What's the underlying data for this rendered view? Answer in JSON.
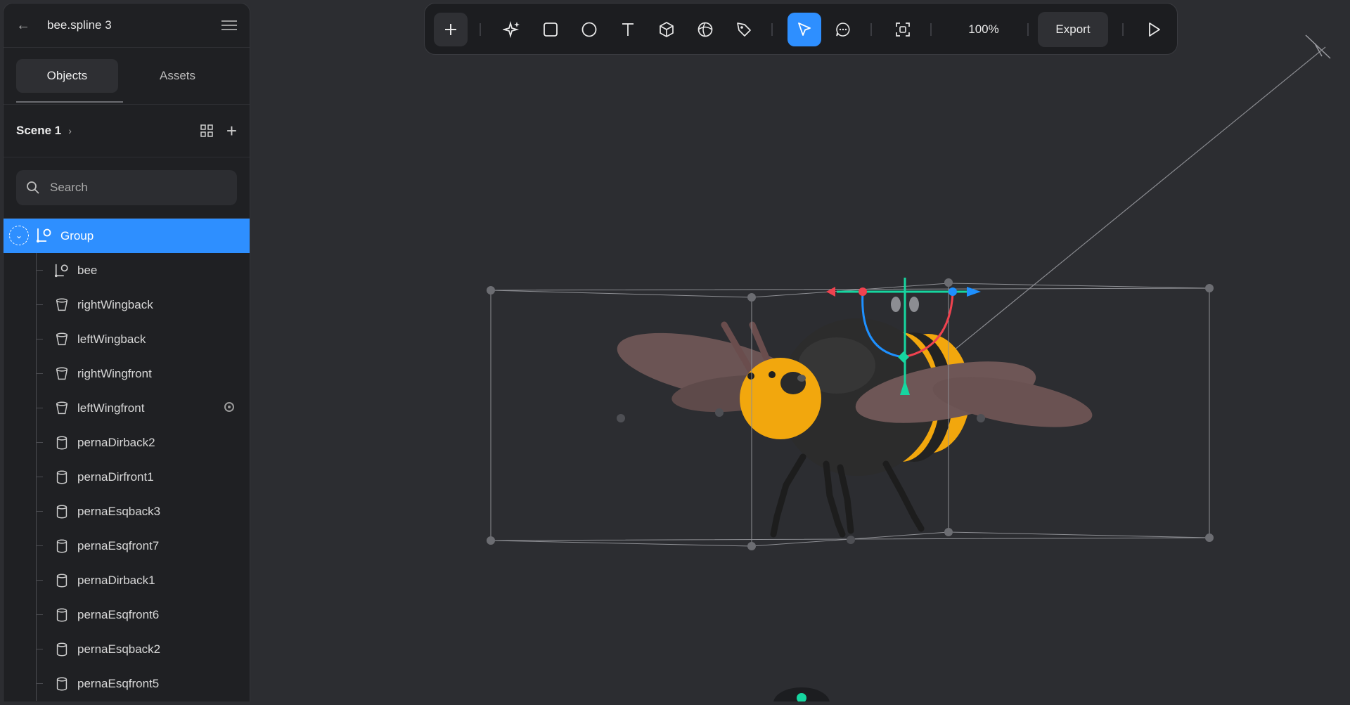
{
  "app": {
    "file_title": "bee.spline 3"
  },
  "sidebar": {
    "tabs": [
      {
        "label": "Objects"
      },
      {
        "label": "Assets"
      }
    ],
    "scene": {
      "label": "Scene 1"
    },
    "search": {
      "placeholder": "Search"
    },
    "selected_item": {
      "label": "Group"
    },
    "items": [
      {
        "label": "bee",
        "icon": "group-icon"
      },
      {
        "label": "rightWingback",
        "icon": "cup-shape-icon"
      },
      {
        "label": "leftWingback",
        "icon": "cup-shape-icon"
      },
      {
        "label": "rightWingfront",
        "icon": "cup-shape-icon"
      },
      {
        "label": "leftWingfront",
        "icon": "cup-shape-icon",
        "has_visibility_toggle": true
      },
      {
        "label": "pernaDirback2",
        "icon": "cylinder-icon"
      },
      {
        "label": "pernaDirfront1",
        "icon": "cylinder-icon"
      },
      {
        "label": "pernaEsqback3",
        "icon": "cylinder-icon"
      },
      {
        "label": "pernaEsqfront7",
        "icon": "cylinder-icon"
      },
      {
        "label": "pernaDirback1",
        "icon": "cylinder-icon"
      },
      {
        "label": "pernaEsqfront6",
        "icon": "cylinder-icon"
      },
      {
        "label": "pernaEsqback2",
        "icon": "cylinder-icon"
      },
      {
        "label": "pernaEsqfront5",
        "icon": "cylinder-icon"
      }
    ]
  },
  "toolbar": {
    "tools": [
      "add-icon",
      "ai-sparkle-icon",
      "rectangle-icon",
      "ellipse-icon",
      "text-icon",
      "cube-icon",
      "sphere-icon",
      "pen-icon",
      "select-cursor-icon",
      "comment-icon",
      "frame-icon"
    ],
    "zoom_label": "100%",
    "export_label": "Export",
    "play_icon": "play-icon"
  },
  "colors": {
    "accent": "#2e8fff",
    "axis_x": "#f0424f",
    "axis_y": "#16d6a0",
    "axis_z": "#1e90ff",
    "bee_yellow": "#f2a70d",
    "bee_body": "#2a2a2a",
    "wing": "#6e5656"
  }
}
